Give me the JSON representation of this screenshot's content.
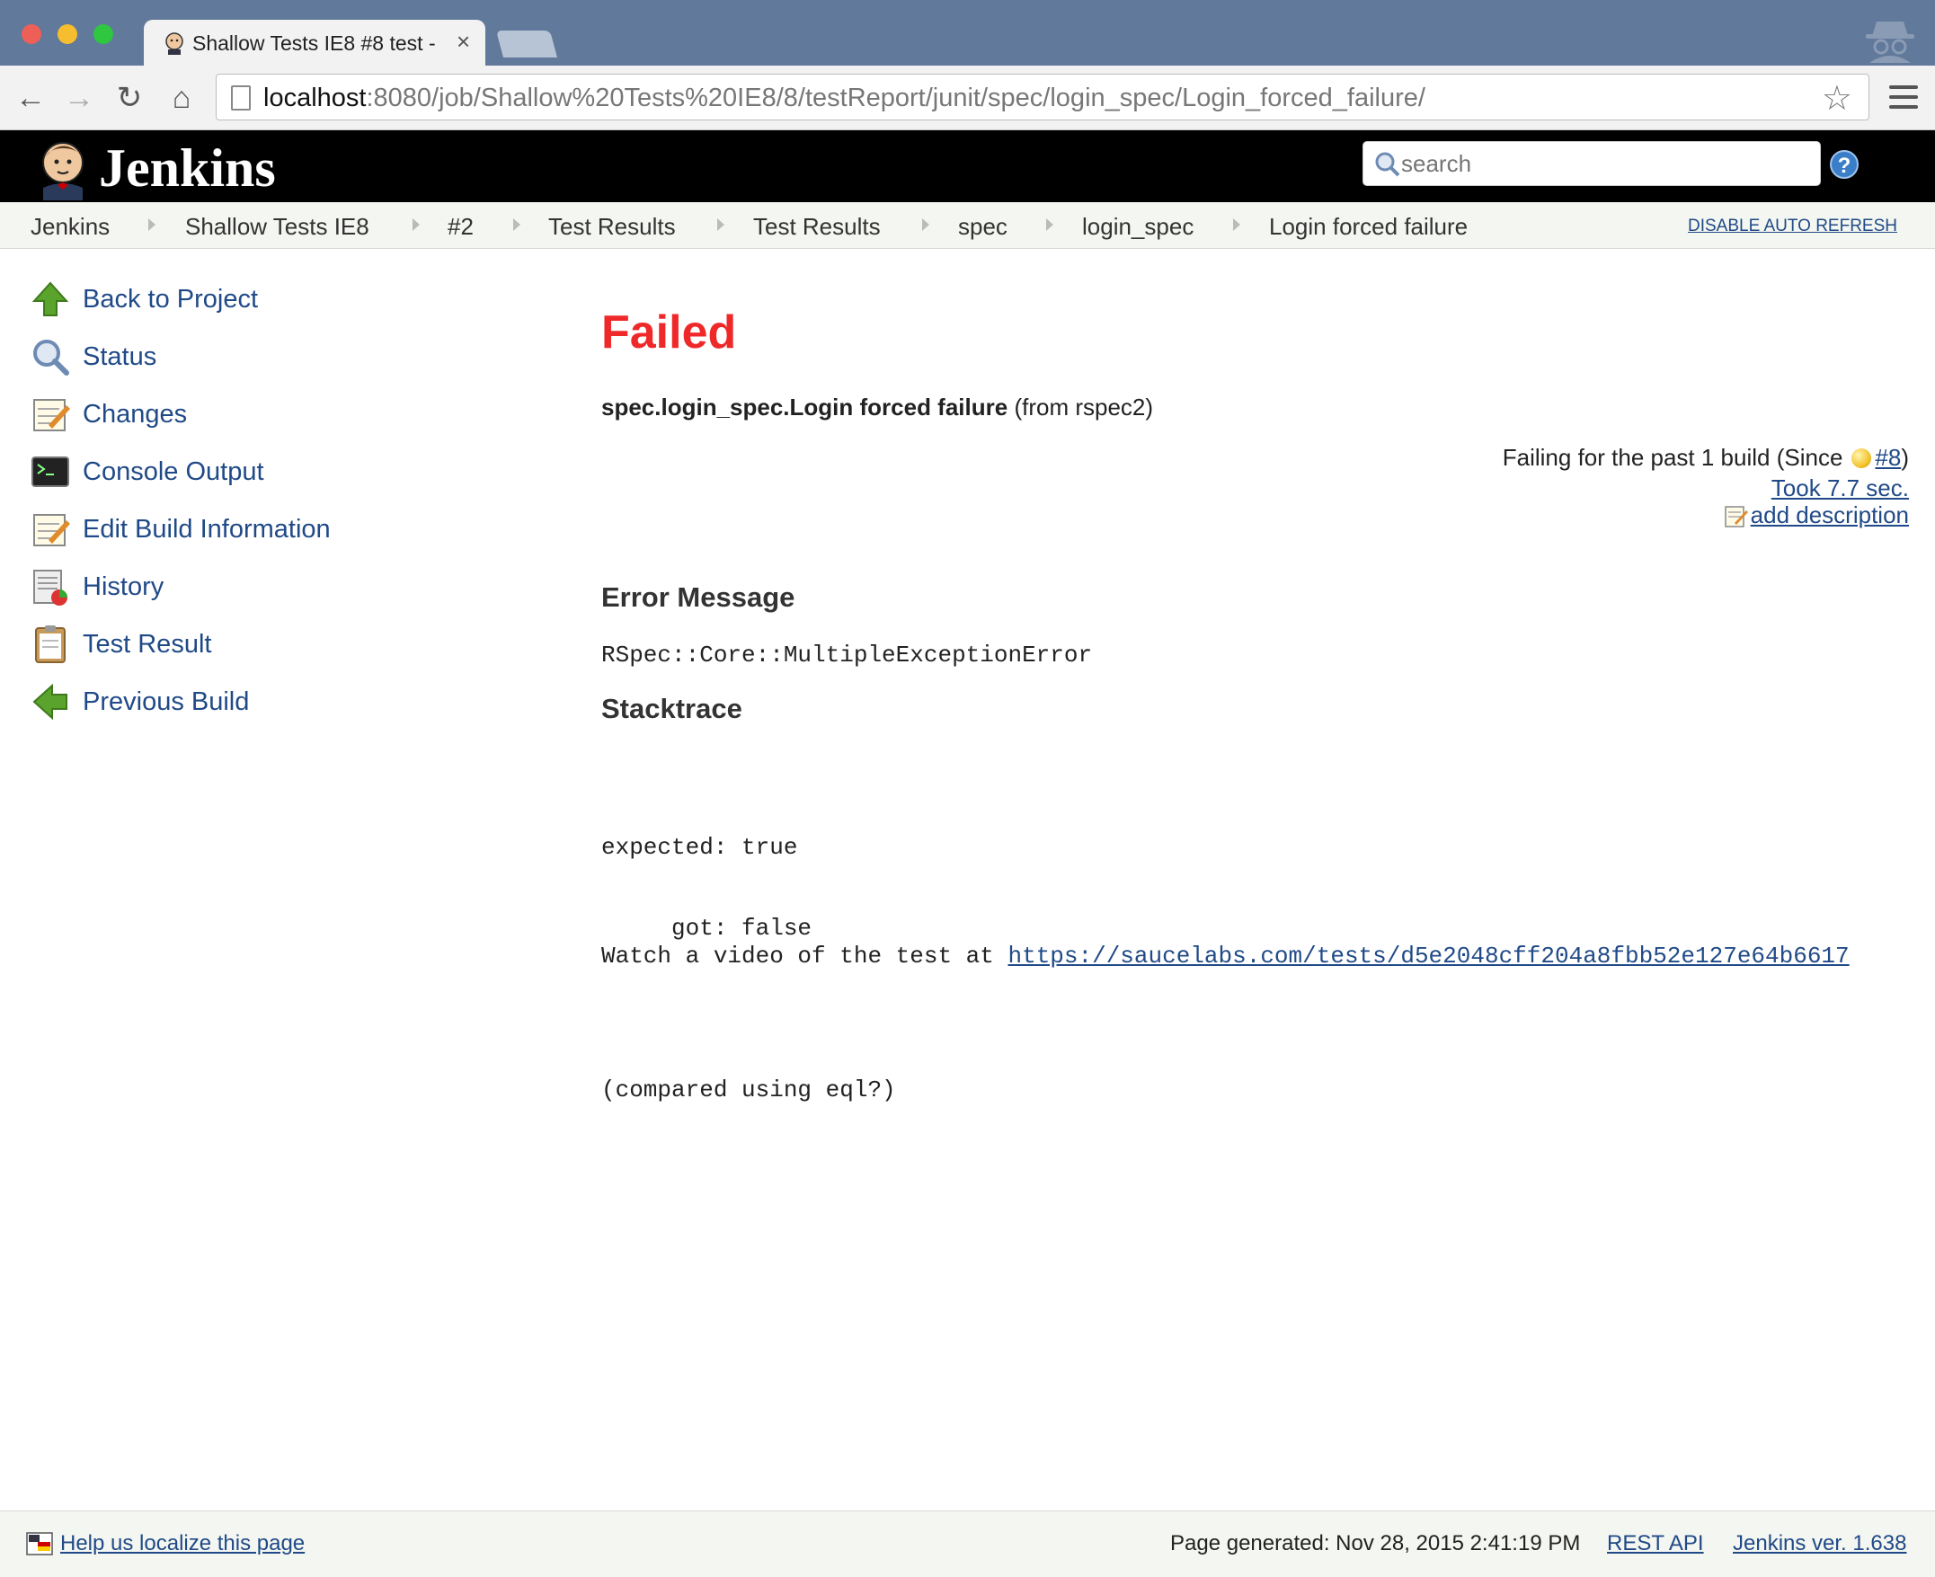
{
  "browser": {
    "tab_title": "Shallow Tests IE8 #8 test -",
    "tab_close": "×",
    "url_host": "localhost",
    "url_rest": ":8080/job/Shallow%20Tests%20IE8/8/testReport/junit/spec/login_spec/Login_forced_failure/",
    "back_glyph": "←",
    "forward_glyph": "→",
    "reload_glyph": "↻",
    "home_glyph": "⌂",
    "star_glyph": "☆"
  },
  "header": {
    "title": "Jenkins",
    "search_placeholder": "search",
    "help_glyph": "?"
  },
  "breadcrumb": {
    "items": [
      "Jenkins",
      "Shallow Tests IE8",
      "#2",
      "Test Results",
      "Test Results",
      "spec",
      "login_spec",
      "Login forced failure"
    ],
    "auto_refresh": "DISABLE AUTO REFRESH"
  },
  "sidebar": {
    "items": [
      {
        "label": "Back to Project",
        "icon": "up-arrow-icon"
      },
      {
        "label": "Status",
        "icon": "magnifier-icon"
      },
      {
        "label": "Changes",
        "icon": "notepad-icon"
      },
      {
        "label": "Console Output",
        "icon": "terminal-icon"
      },
      {
        "label": "Edit Build Information",
        "icon": "notepad-icon"
      },
      {
        "label": "History",
        "icon": "chart-icon"
      },
      {
        "label": "Test Result",
        "icon": "clipboard-icon"
      },
      {
        "label": "Previous Build",
        "icon": "left-arrow-icon"
      }
    ]
  },
  "main": {
    "status": "Failed",
    "test_name_bold": "spec.login_spec.Login forced failure",
    "test_name_suffix": " (from rspec2)",
    "failing_prefix": "Failing for the past 1 build (Since ",
    "failing_build": "#8",
    "failing_suffix": " )",
    "took": "Took 7.7 sec.",
    "add_description": "add description",
    "error_heading": "Error Message",
    "error_message": "RSpec::Core::MultipleExceptionError",
    "stack_heading": "Stacktrace",
    "stack_lines": [
      "expected: true",
      "     got: false",
      "",
      "(compared using eql?)"
    ],
    "video_prefix": "Watch a video of the test at ",
    "video_url": "https://saucelabs.com/tests/d5e2048cff204a8fbb52e127e64b6617"
  },
  "footer": {
    "localize": "Help us localize this page",
    "page_generated": "Page generated: Nov 28, 2015 2:41:19 PM",
    "rest_api": "REST API",
    "version": "Jenkins ver. 1.638"
  },
  "colors": {
    "failed": "#ef2929",
    "link": "#204a87",
    "titlebar": "#61799a"
  }
}
